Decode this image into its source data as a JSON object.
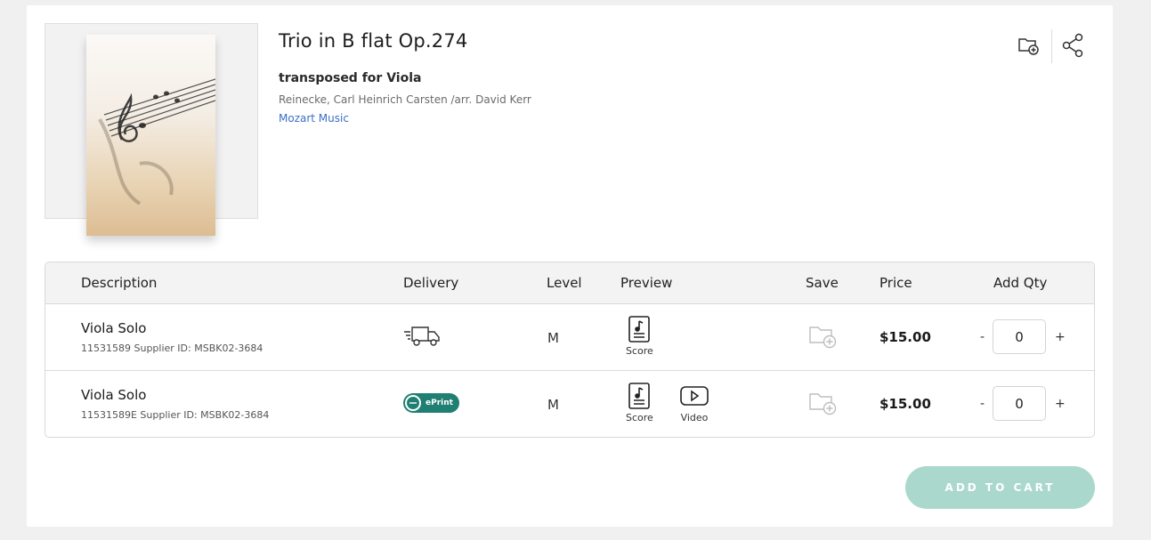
{
  "product": {
    "title": "Trio in B flat Op.274",
    "subtitle": "transposed for Viola",
    "composer": "Reinecke, Carl Heinrich Carsten /arr. David Kerr",
    "publisher": "Mozart Music"
  },
  "header_icons": {
    "save": "folder-plus-icon",
    "share": "share-icon"
  },
  "table": {
    "columns": [
      "Description",
      "Delivery",
      "Level",
      "Preview",
      "Save",
      "Price",
      "Add Qty"
    ],
    "rows": [
      {
        "name": "Viola Solo",
        "id_line": "11531589 Supplier ID: MSBK02-3684",
        "delivery": "truck-icon",
        "level": "M",
        "preview": [
          {
            "label": "Score",
            "icon": "score-icon"
          }
        ],
        "save": "folder-plus-icon",
        "price": "$15.00",
        "qty": "0",
        "minus": "-",
        "plus": "+"
      },
      {
        "name": "Viola Solo",
        "id_line": "11531589E Supplier ID: MSBK02-3684",
        "delivery": "ePrint",
        "level": "M",
        "preview": [
          {
            "label": "Score",
            "icon": "score-icon"
          },
          {
            "label": "Video",
            "icon": "play-icon"
          }
        ],
        "save": "folder-plus-icon",
        "price": "$15.00",
        "qty": "0",
        "minus": "-",
        "plus": "+"
      }
    ]
  },
  "cart_button": "ADD TO CART",
  "colors": {
    "accent_link": "#3b6fc7",
    "eprint_badge": "#1f7f72",
    "cart_button": "#abd8cd"
  }
}
